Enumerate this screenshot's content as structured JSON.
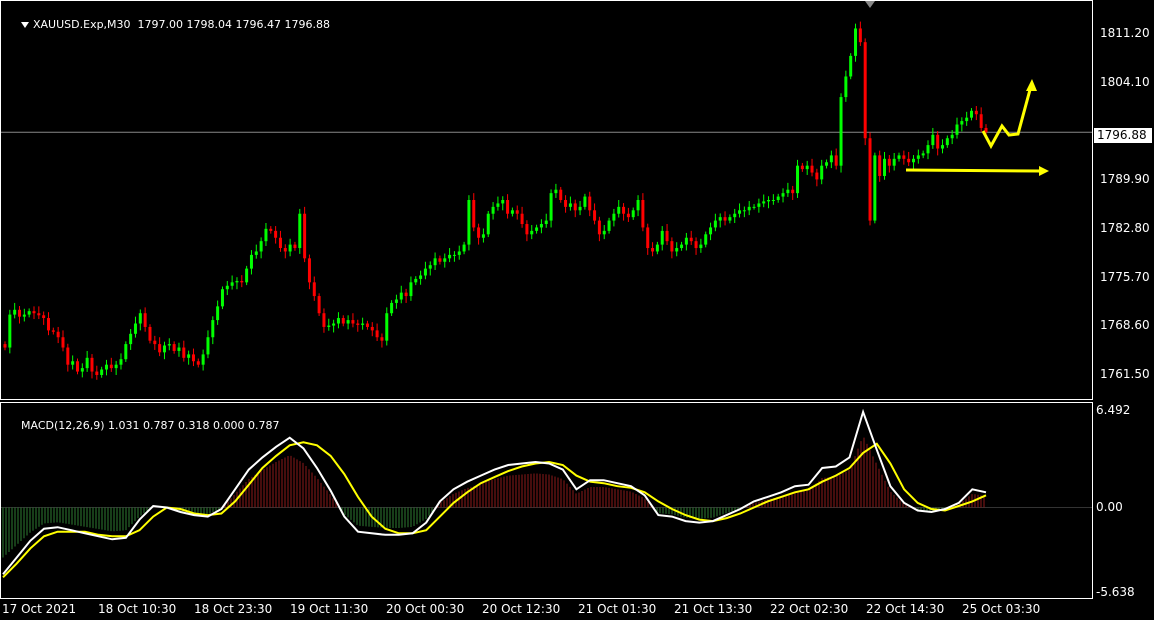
{
  "symbol_info": {
    "symbol": "XAUUSD.Exp,M30",
    "open": "1797.00",
    "high": "1798.04",
    "low": "1796.47",
    "close": "1796.88"
  },
  "indicator_info": {
    "name": "MACD(12,26,9)",
    "values": "1.031 0.787 0.318 0.000 0.787"
  },
  "price_axis": [
    "1811.20",
    "1804.10",
    "1796.88",
    "1789.90",
    "1782.80",
    "1775.70",
    "1768.60",
    "1761.50"
  ],
  "current_price": "1796.88",
  "macd_axis": [
    "6.492",
    "0.00",
    "-5.638"
  ],
  "time_axis": [
    "17 Oct 2021",
    "18 Oct 10:30",
    "18 Oct 23:30",
    "19 Oct 11:30",
    "20 Oct 00:30",
    "20 Oct 12:30",
    "21 Oct 01:30",
    "21 Oct 13:30",
    "22 Oct 02:30",
    "22 Oct 14:30",
    "25 Oct 03:30"
  ],
  "colors": {
    "background": "#000000",
    "bull_candle": "#00ff00",
    "bear_candle": "#ff0000",
    "hist_pos": "#8b1a1a",
    "hist_neg": "#2e7d32",
    "macd_line": "#ffffff",
    "signal_line": "#ffff00",
    "annotation": "#ffff00"
  },
  "chart_data": {
    "type": "candlestick",
    "price_ylim": [
      1758.0,
      1816.0
    ],
    "closes": [
      1765.5,
      1770.3,
      1771.0,
      1770.0,
      1770.3,
      1770.8,
      1770.5,
      1770.2,
      1769.8,
      1768.0,
      1767.8,
      1767.0,
      1765.5,
      1763.0,
      1763.5,
      1762.0,
      1762.5,
      1764.0,
      1762.0,
      1761.5,
      1762.3,
      1763.0,
      1762.5,
      1763.0,
      1763.8,
      1766.0,
      1767.5,
      1769.0,
      1770.5,
      1768.5,
      1766.5,
      1766.0,
      1764.8,
      1765.8,
      1766.0,
      1765.0,
      1765.5,
      1764.0,
      1764.5,
      1763.5,
      1763.0,
      1764.5,
      1767.0,
      1769.5,
      1771.5,
      1774.0,
      1774.5,
      1775.0,
      1775.2,
      1775.0,
      1777.0,
      1779.0,
      1779.5,
      1781.0,
      1782.8,
      1782.5,
      1781.5,
      1780.0,
      1779.5,
      1780.5,
      1780.0,
      1785.0,
      1778.5,
      1775.0,
      1773.0,
      1770.5,
      1768.5,
      1768.7,
      1769.0,
      1769.8,
      1769.0,
      1769.5,
      1769.0,
      1768.8,
      1769.0,
      1768.5,
      1768.0,
      1767.0,
      1766.5,
      1770.5,
      1772.0,
      1772.5,
      1773.5,
      1773.0,
      1775.0,
      1775.5,
      1776.0,
      1777.0,
      1777.5,
      1778.5,
      1778.0,
      1778.5,
      1779.0,
      1779.0,
      1779.5,
      1780.5,
      1787.0,
      1783.0,
      1781.5,
      1782.0,
      1785.0,
      1786.0,
      1786.5,
      1787.0,
      1785.0,
      1785.5,
      1785.0,
      1783.5,
      1782.0,
      1782.5,
      1783.0,
      1783.5,
      1784.0,
      1788.0,
      1788.5,
      1787.0,
      1786.0,
      1786.5,
      1785.5,
      1786.0,
      1787.5,
      1785.5,
      1784.0,
      1782.0,
      1782.5,
      1784.0,
      1785.0,
      1786.0,
      1785.0,
      1784.5,
      1785.5,
      1787.0,
      1783.0,
      1780.0,
      1779.5,
      1780.5,
      1782.5,
      1781.0,
      1779.5,
      1780.0,
      1780.5,
      1781.5,
      1781.0,
      1780.0,
      1780.5,
      1782.0,
      1783.0,
      1784.0,
      1784.5,
      1784.0,
      1784.5,
      1785.0,
      1785.5,
      1785.5,
      1786.0,
      1786.0,
      1786.5,
      1786.8,
      1787.0,
      1787.0,
      1787.5,
      1788.0,
      1788.5,
      1788.0,
      1792.0,
      1791.5,
      1792.0,
      1791.0,
      1790.0,
      1792.0,
      1792.5,
      1793.5,
      1792.0,
      1802.0,
      1805.0,
      1808.0,
      1812.0,
      1810.0,
      1796.0,
      1784.0,
      1793.5,
      1790.5,
      1793.0,
      1792.0,
      1793.0,
      1793.5,
      1793.0,
      1792.5,
      1793.0,
      1793.5,
      1793.8,
      1795.0,
      1796.5,
      1794.5,
      1795.0,
      1796.0,
      1796.5,
      1798.0,
      1798.5,
      1799.0,
      1800.0,
      1799.5,
      1797.5,
      1796.88
    ],
    "macd_ylim": [
      -5.638,
      6.492
    ],
    "macd_line": [
      -4.4,
      -3.3,
      -2.2,
      -1.4,
      -1.3,
      -1.5,
      -1.7,
      -1.9,
      -2.1,
      -2.0,
      -0.8,
      0.1,
      0.0,
      -0.3,
      -0.5,
      -0.6,
      -0.1,
      1.2,
      2.5,
      3.3,
      4.0,
      4.6,
      3.9,
      2.6,
      1.1,
      -0.6,
      -1.6,
      -1.7,
      -1.8,
      -1.8,
      -1.7,
      -1.0,
      0.4,
      1.2,
      1.7,
      2.1,
      2.5,
      2.8,
      2.9,
      3.0,
      2.9,
      2.5,
      1.2,
      1.8,
      1.8,
      1.6,
      1.4,
      0.8,
      -0.5,
      -0.6,
      -0.9,
      -1.0,
      -0.9,
      -0.5,
      -0.1,
      0.4,
      0.7,
      1.0,
      1.4,
      1.5,
      2.6,
      2.7,
      3.3,
      6.3,
      3.8,
      1.4,
      0.3,
      -0.2,
      -0.3,
      -0.1,
      0.3,
      1.2,
      1.0
    ],
    "signal_line": [
      -4.6,
      -3.7,
      -2.7,
      -1.9,
      -1.6,
      -1.6,
      -1.6,
      -1.8,
      -1.9,
      -1.9,
      -1.5,
      -0.6,
      0.0,
      -0.1,
      -0.4,
      -0.5,
      -0.4,
      0.4,
      1.5,
      2.6,
      3.4,
      4.1,
      4.3,
      4.1,
      3.4,
      2.2,
      0.7,
      -0.6,
      -1.4,
      -1.7,
      -1.7,
      -1.5,
      -0.6,
      0.3,
      1.0,
      1.6,
      2.0,
      2.4,
      2.7,
      2.9,
      3.0,
      2.8,
      2.1,
      1.7,
      1.6,
      1.4,
      1.3,
      1.0,
      0.4,
      -0.1,
      -0.5,
      -0.8,
      -0.9,
      -0.7,
      -0.4,
      0.0,
      0.4,
      0.7,
      1.0,
      1.2,
      1.7,
      2.1,
      2.6,
      3.6,
      4.2,
      2.9,
      1.2,
      0.3,
      -0.1,
      -0.2,
      0.1,
      0.4,
      0.8
    ]
  }
}
